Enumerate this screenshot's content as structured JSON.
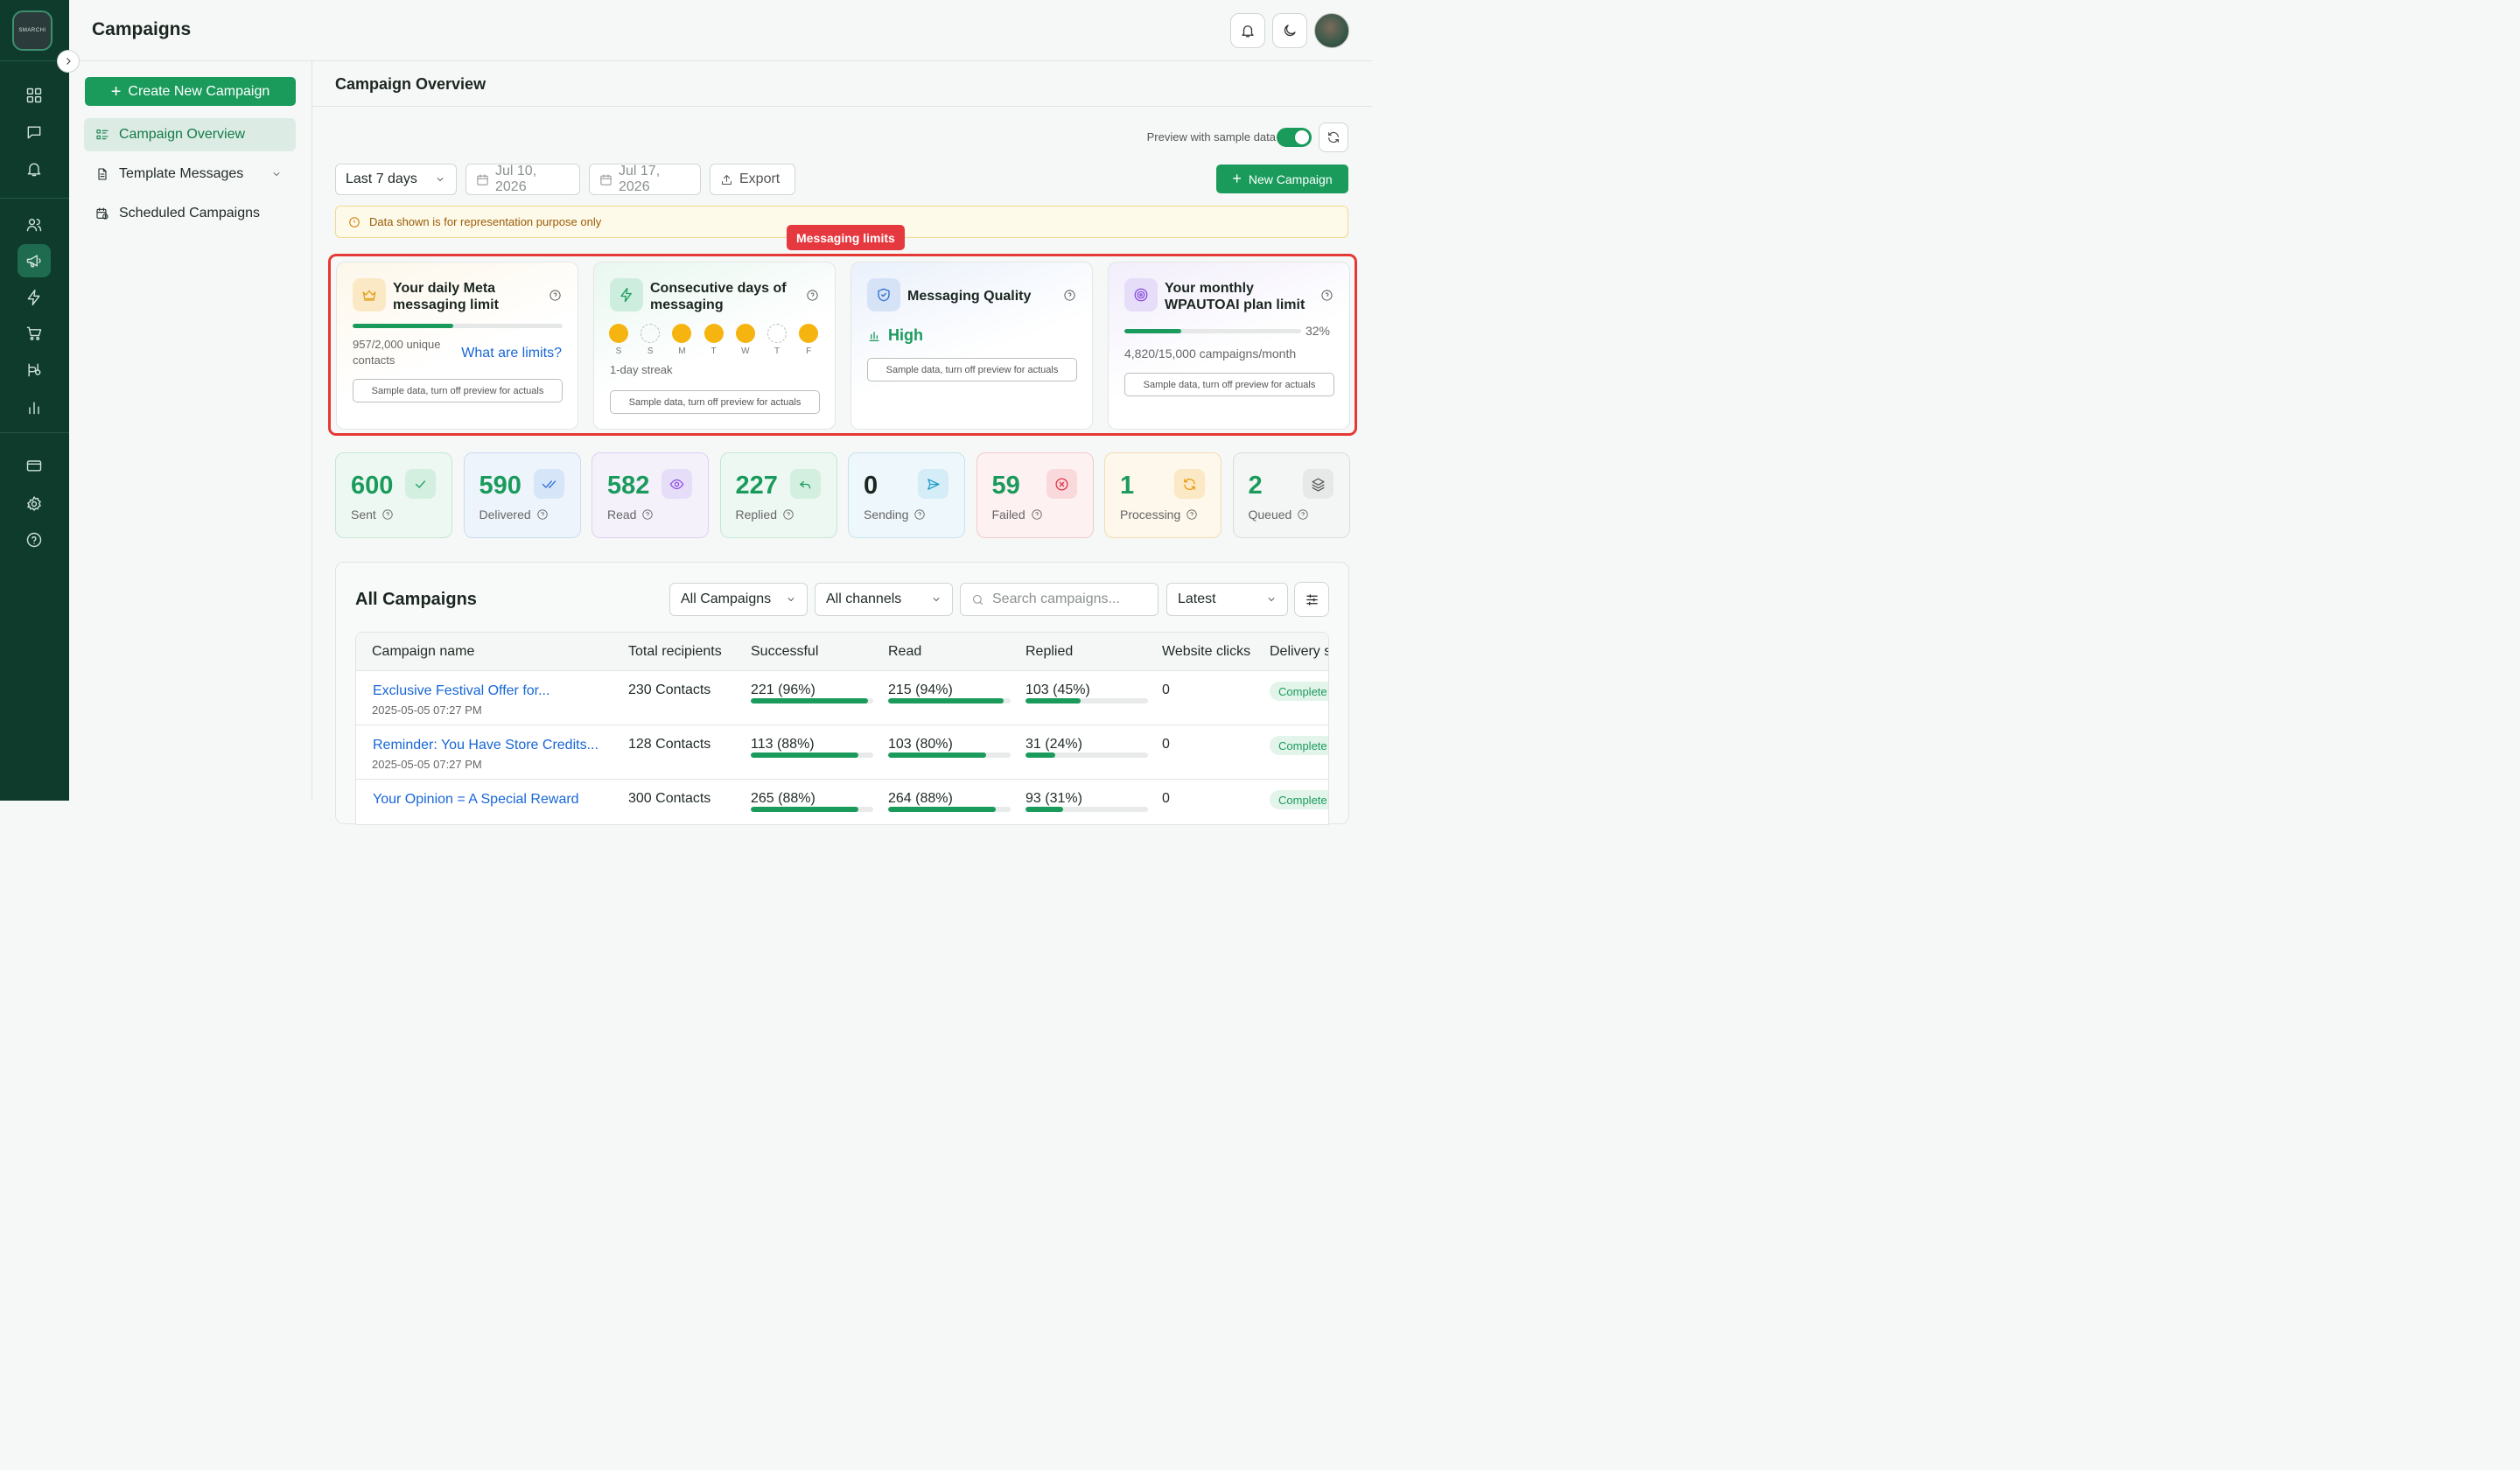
{
  "app": {
    "logo_text": "SMARCHI",
    "page_title": "Campaigns"
  },
  "subnav": {
    "create_label": "Create New Campaign",
    "items": [
      {
        "label": "Campaign Overview",
        "icon": "overview-icon",
        "active": true
      },
      {
        "label": "Template Messages",
        "icon": "document-icon",
        "has_chevron": true
      },
      {
        "label": "Scheduled Campaigns",
        "icon": "calendar-clock-icon"
      }
    ]
  },
  "main": {
    "section_title": "Campaign Overview",
    "preview_label": "Preview with sample data",
    "preview_enabled": true,
    "range_select": "Last 7 days",
    "date_from": "Jul 10, 2026",
    "date_to": "Jul 17, 2026",
    "export_label": "Export",
    "new_campaign_label": "New Campaign",
    "notice": "Data shown is for representation purpose only",
    "limits_tag": "Messaging limits"
  },
  "limits": {
    "meta": {
      "title": "Your daily Meta messaging limit",
      "usage": "957/2,000 unique contacts",
      "link": "What are limits?",
      "progress": 0.48,
      "sample": "Sample data, turn off preview for actuals"
    },
    "streak": {
      "title": "Consecutive days of messaging",
      "days": [
        {
          "d": "S",
          "on": true
        },
        {
          "d": "S",
          "on": false
        },
        {
          "d": "M",
          "on": true
        },
        {
          "d": "T",
          "on": true
        },
        {
          "d": "W",
          "on": true
        },
        {
          "d": "T",
          "on": false
        },
        {
          "d": "F",
          "on": true
        }
      ],
      "streak_text": "1-day streak",
      "sample": "Sample data, turn off preview for actuals"
    },
    "quality": {
      "title": "Messaging Quality",
      "value": "High",
      "sample": "Sample data, turn off preview for actuals"
    },
    "plan": {
      "title": "Your monthly WPAUTOAI plan limit",
      "percent_label": "32%",
      "progress": 0.32,
      "usage": "4,820/15,000 campaigns/month",
      "sample": "Sample data, turn off preview for actuals"
    }
  },
  "stats": [
    {
      "value": "600",
      "label": "Sent",
      "color": "#1a9b5c",
      "bg": "#eef8f3",
      "border": "#c5e6d5",
      "icon": "check-icon"
    },
    {
      "value": "590",
      "label": "Delivered",
      "color": "#1a9b5c",
      "bg": "#eef4fb",
      "border": "#c9dcf2",
      "icon": "double-check-icon"
    },
    {
      "value": "582",
      "label": "Read",
      "color": "#1a9b5c",
      "bg": "#f4f1fb",
      "border": "#dcd2f2",
      "icon": "eye-icon"
    },
    {
      "value": "227",
      "label": "Replied",
      "color": "#1a9b5c",
      "bg": "#eef8f3",
      "border": "#c5e6d5",
      "icon": "reply-icon"
    },
    {
      "value": "0",
      "label": "Sending",
      "color": "#1b2620",
      "bg": "#eef7fb",
      "border": "#c7e2ee",
      "icon": "send-icon"
    },
    {
      "value": "59",
      "label": "Failed",
      "color": "#1a9b5c",
      "bg": "#fdf1f2",
      "border": "#f2c9cd",
      "icon": "x-circle-icon"
    },
    {
      "value": "1",
      "label": "Processing",
      "color": "#1a9b5c",
      "bg": "#fdf7ec",
      "border": "#f1dcb2",
      "icon": "refresh-icon"
    },
    {
      "value": "2",
      "label": "Queued",
      "color": "#1a9b5c",
      "bg": "#f4f5f5",
      "border": "#d9dddb",
      "icon": "layers-icon"
    }
  ],
  "campaigns": {
    "title": "All Campaigns",
    "filter_type": "All Campaigns",
    "filter_channel": "All channels",
    "search_placeholder": "Search campaigns...",
    "sort": "Latest",
    "columns": [
      "Campaign name",
      "Total recipients",
      "Successful",
      "Read",
      "Replied",
      "Website clicks",
      "Delivery s"
    ],
    "rows": [
      {
        "name": "Exclusive Festival Offer for...",
        "date": "2025-05-05 07:27 PM",
        "recipients": "230 Contacts",
        "successful": "221 (96%)",
        "successful_pct": 0.96,
        "read": "215 (94%)",
        "read_pct": 0.94,
        "replied": "103 (45%)",
        "replied_pct": 0.45,
        "clicks": "0",
        "status": "Complete"
      },
      {
        "name": "Reminder: You Have Store Credits...",
        "date": "2025-05-05 07:27 PM",
        "recipients": "128 Contacts",
        "successful": "113 (88%)",
        "successful_pct": 0.88,
        "read": "103 (80%)",
        "read_pct": 0.8,
        "replied": "31 (24%)",
        "replied_pct": 0.24,
        "clicks": "0",
        "status": "Complete"
      },
      {
        "name": "Your Opinion = A Special Reward",
        "date": "",
        "recipients": "300 Contacts",
        "successful": "265 (88%)",
        "successful_pct": 0.88,
        "read": "264 (88%)",
        "read_pct": 0.88,
        "replied": "93 (31%)",
        "replied_pct": 0.31,
        "clicks": "0",
        "status": "Complete"
      }
    ]
  }
}
